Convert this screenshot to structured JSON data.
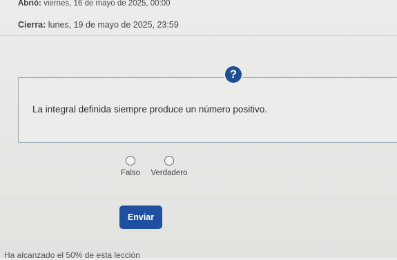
{
  "schedule": {
    "opens_label": "Abrió:",
    "opens_value": "viernes, 16 de mayo de 2025, 00:00",
    "closes_label": "Cierra:",
    "closes_value": "lunes, 19 de mayo de 2025, 23:59"
  },
  "help_icon": {
    "glyph": "?",
    "icon": "question-mark-icon",
    "color": "#1f4f93"
  },
  "question": {
    "text": "La integral definida siempre produce un número positivo."
  },
  "options": [
    {
      "label": "Falso"
    },
    {
      "label": "Verdadero"
    }
  ],
  "submit": {
    "label": "Enviar",
    "color": "#1e4fa1"
  },
  "progress": {
    "text": "Ha alcanzado el 50% de esta lección"
  }
}
